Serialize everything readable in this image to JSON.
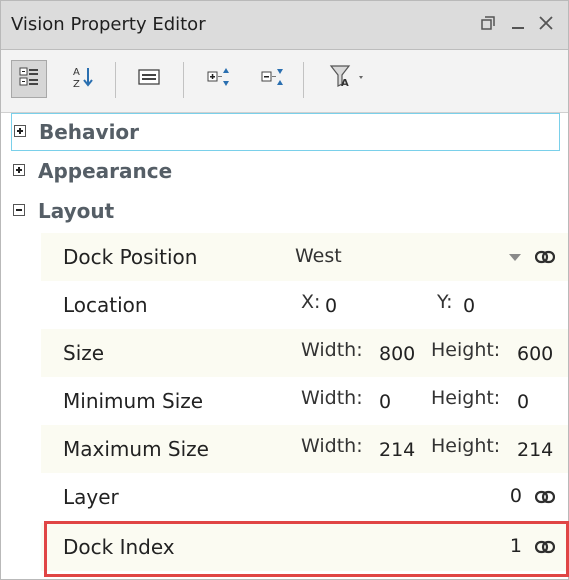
{
  "window": {
    "title": "Vision Property Editor"
  },
  "toolbar": {
    "buttons": [
      "categorize-icon",
      "sort-alpha-icon",
      "description-icon",
      "expand-all-icon",
      "collapse-all-icon",
      "filter-icon"
    ]
  },
  "categories": [
    {
      "label": "Behavior",
      "expanded": false
    },
    {
      "label": "Appearance",
      "expanded": false
    },
    {
      "label": "Layout",
      "expanded": true
    }
  ],
  "layout": {
    "dock_position": {
      "label": "Dock Position",
      "value": "West"
    },
    "location": {
      "label": "Location",
      "x_label": "X:",
      "x": "0",
      "y_label": "Y:",
      "y": "0"
    },
    "size": {
      "label": "Size",
      "w_label": "Width:",
      "w": "800",
      "h_label": "Height:",
      "h": "600"
    },
    "min_size": {
      "label": "Minimum Size",
      "w_label": "Width:",
      "w": "0",
      "h_label": "Height:",
      "h": "0"
    },
    "max_size": {
      "label": "Maximum Size",
      "w_label": "Width:",
      "w": "214",
      "h_label": "Height:",
      "h": "214"
    },
    "layer": {
      "label": "Layer",
      "value": "0"
    },
    "dock_index": {
      "label": "Dock Index",
      "value": "1"
    }
  },
  "colors": {
    "highlight": "#e04545",
    "selection": "#7ad0ea"
  }
}
